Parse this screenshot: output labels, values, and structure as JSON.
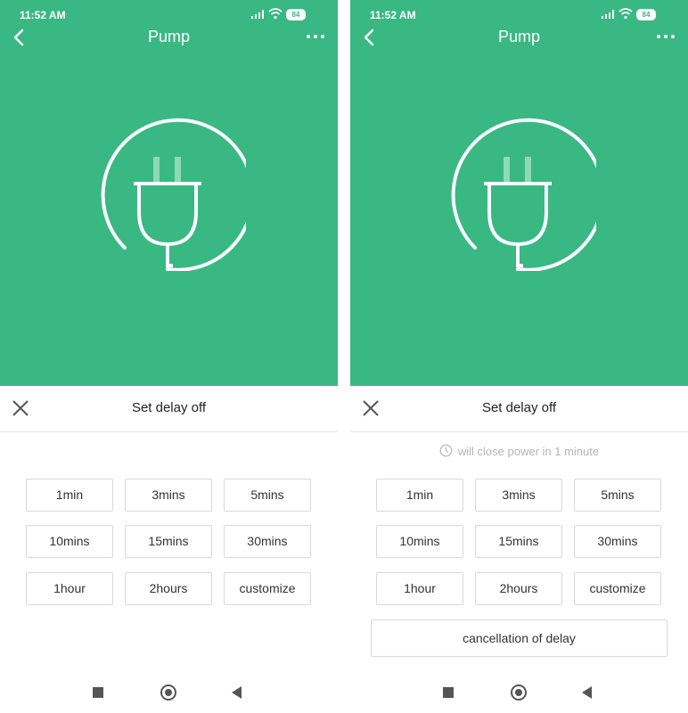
{
  "left": {
    "status": {
      "time": "11:52 AM",
      "battery": "84"
    },
    "header": {
      "title": "Pump"
    },
    "sheet": {
      "title": "Set delay off"
    },
    "options": [
      "1min",
      "3mins",
      "5mins",
      "10mins",
      "15mins",
      "30mins",
      "1hour",
      "2hours",
      "customize"
    ]
  },
  "right": {
    "status": {
      "time": "11:52 AM",
      "battery": "84"
    },
    "header": {
      "title": "Pump"
    },
    "sheet": {
      "title": "Set delay off",
      "info": "will close power in 1 minute"
    },
    "options": [
      "1min",
      "3mins",
      "5mins",
      "10mins",
      "15mins",
      "30mins",
      "1hour",
      "2hours",
      "customize"
    ],
    "cancel_label": "cancellation of delay"
  },
  "colors": {
    "brand_green": "#39b884"
  },
  "icons": [
    "back-arrow-icon",
    "more-icon",
    "plug-icon",
    "close-icon",
    "clock-icon",
    "signal-icon",
    "wifi-icon",
    "battery-icon",
    "nav-square-icon",
    "nav-home-icon",
    "nav-back-icon"
  ]
}
